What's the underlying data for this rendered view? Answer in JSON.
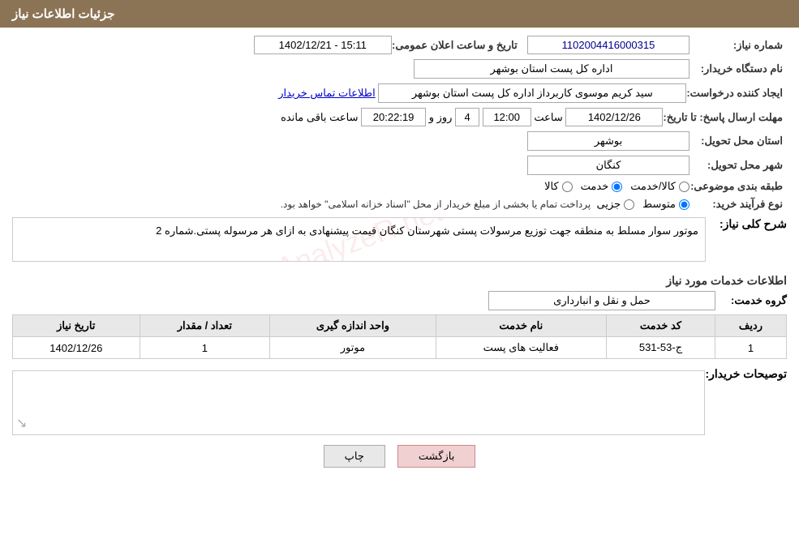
{
  "header": {
    "title": "جزئیات اطلاعات نیاز"
  },
  "fields": {
    "need_number_label": "شماره نیاز:",
    "need_number_value": "1102004416000315",
    "announce_date_label": "تاریخ و ساعت اعلان عمومی:",
    "announce_date_value": "1402/12/21 - 15:11",
    "org_name_label": "نام دستگاه خریدار:",
    "org_name_value": "اداره کل پست استان بوشهر",
    "creator_label": "ایجاد کننده درخواست:",
    "creator_value": "سید کریم موسوی کاربرداز اداره کل پست استان بوشهر",
    "contact_link": "اطلاعات تماس خریدار",
    "deadline_label": "مهلت ارسال پاسخ: تا تاریخ:",
    "deadline_date": "1402/12/26",
    "deadline_time_label": "ساعت",
    "deadline_time": "12:00",
    "deadline_days_label": "روز و",
    "deadline_days": "4",
    "deadline_remaining_label": "ساعت باقی مانده",
    "deadline_remaining": "20:22:19",
    "province_label": "استان محل تحویل:",
    "province_value": "بوشهر",
    "city_label": "شهر محل تحویل:",
    "city_value": "کنگان",
    "category_label": "طبقه بندی موضوعی:",
    "category_kala": "کالا",
    "category_khadamat": "خدمت",
    "category_kala_khadamat": "کالا/خدمت",
    "purchase_type_label": "نوع فرآیند خرید:",
    "purchase_jozii": "جزیی",
    "purchase_motawaset": "متوسط",
    "purchase_note": "پرداخت تمام یا بخشی از مبلغ خریدار از محل \"اسناد خزانه اسلامی\" خواهد بود.",
    "narration_label": "شرح کلی نیاز:",
    "narration_text": "موتور سوار مسلط به منطقه جهت توزیع مرسولات پستی شهرستان  کنگان قیمت پیشنهادی به ازای هر مرسوله پستی.شماره 2",
    "services_section_label": "اطلاعات خدمات مورد نیاز",
    "service_group_label": "گروه خدمت:",
    "service_group_value": "حمل و نقل و انبارداری",
    "table": {
      "headers": [
        "ردیف",
        "کد خدمت",
        "نام خدمت",
        "واحد اندازه گیری",
        "تعداد / مقدار",
        "تاریخ نیاز"
      ],
      "rows": [
        {
          "row": "1",
          "code": "ج-53-531",
          "name": "فعالیت های پست",
          "unit": "موتور",
          "quantity": "1",
          "date": "1402/12/26"
        }
      ]
    },
    "buyer_desc_label": "توصیحات خریدار:",
    "back_button": "بازگشت",
    "print_button": "چاپ"
  }
}
